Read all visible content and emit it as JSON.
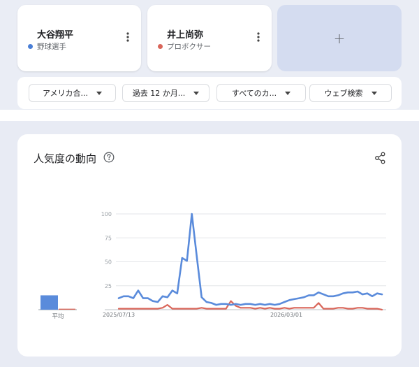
{
  "terms": [
    {
      "name": "大谷翔平",
      "category": "野球選手",
      "color": "#4a7fd6"
    },
    {
      "name": "井上尚弥",
      "category": "プロボクサー",
      "color": "#d9665a"
    }
  ],
  "add_term": {
    "label": "+"
  },
  "filters": [
    {
      "label": "アメリカ合..."
    },
    {
      "label": "過去 12 か月..."
    },
    {
      "label": "すべてのカ..."
    },
    {
      "label": "ウェブ検索"
    }
  ],
  "chart": {
    "title": "人気度の動向"
  },
  "colors": {
    "series_1": "#5a8bdb",
    "series_2": "#d9665a",
    "grid": "#e3e5e8"
  },
  "chart_data": [
    {
      "type": "bar",
      "categories": [
        "平均"
      ],
      "series": [
        {
          "name": "大谷翔平",
          "values": [
            15
          ]
        },
        {
          "name": "井上尚弥",
          "values": [
            1
          ]
        }
      ],
      "ylim": [
        0,
        100
      ]
    },
    {
      "type": "line",
      "ylim": [
        0,
        100
      ],
      "yticks": [
        "100",
        "75",
        "50",
        "25"
      ],
      "xticks": [
        "2025/07/13",
        "2026/03/01"
      ],
      "series": [
        {
          "name": "大谷翔平",
          "values": [
            12,
            14,
            14,
            12,
            20,
            12,
            12,
            9,
            8,
            14,
            13,
            20,
            17,
            54,
            51,
            100,
            56,
            13,
            8,
            7,
            5,
            6,
            6,
            5,
            6,
            5,
            6,
            6,
            5,
            6,
            5,
            6,
            5,
            6,
            8,
            10,
            11,
            12,
            13,
            15,
            15,
            18,
            16,
            14,
            14,
            15,
            17,
            18,
            18,
            19,
            16,
            17,
            14,
            17,
            16
          ]
        },
        {
          "name": "井上尚弥",
          "values": [
            1,
            1,
            1,
            1,
            1,
            1,
            1,
            1,
            1,
            2,
            5,
            1,
            1,
            1,
            1,
            1,
            1,
            2,
            1,
            1,
            1,
            1,
            1,
            9,
            4,
            2,
            2,
            2,
            1,
            2,
            1,
            2,
            1,
            1,
            2,
            1,
            2,
            2,
            2,
            2,
            2,
            7,
            1,
            1,
            1,
            2,
            2,
            1,
            1,
            2,
            2,
            1,
            1,
            1,
            0
          ]
        }
      ]
    }
  ]
}
